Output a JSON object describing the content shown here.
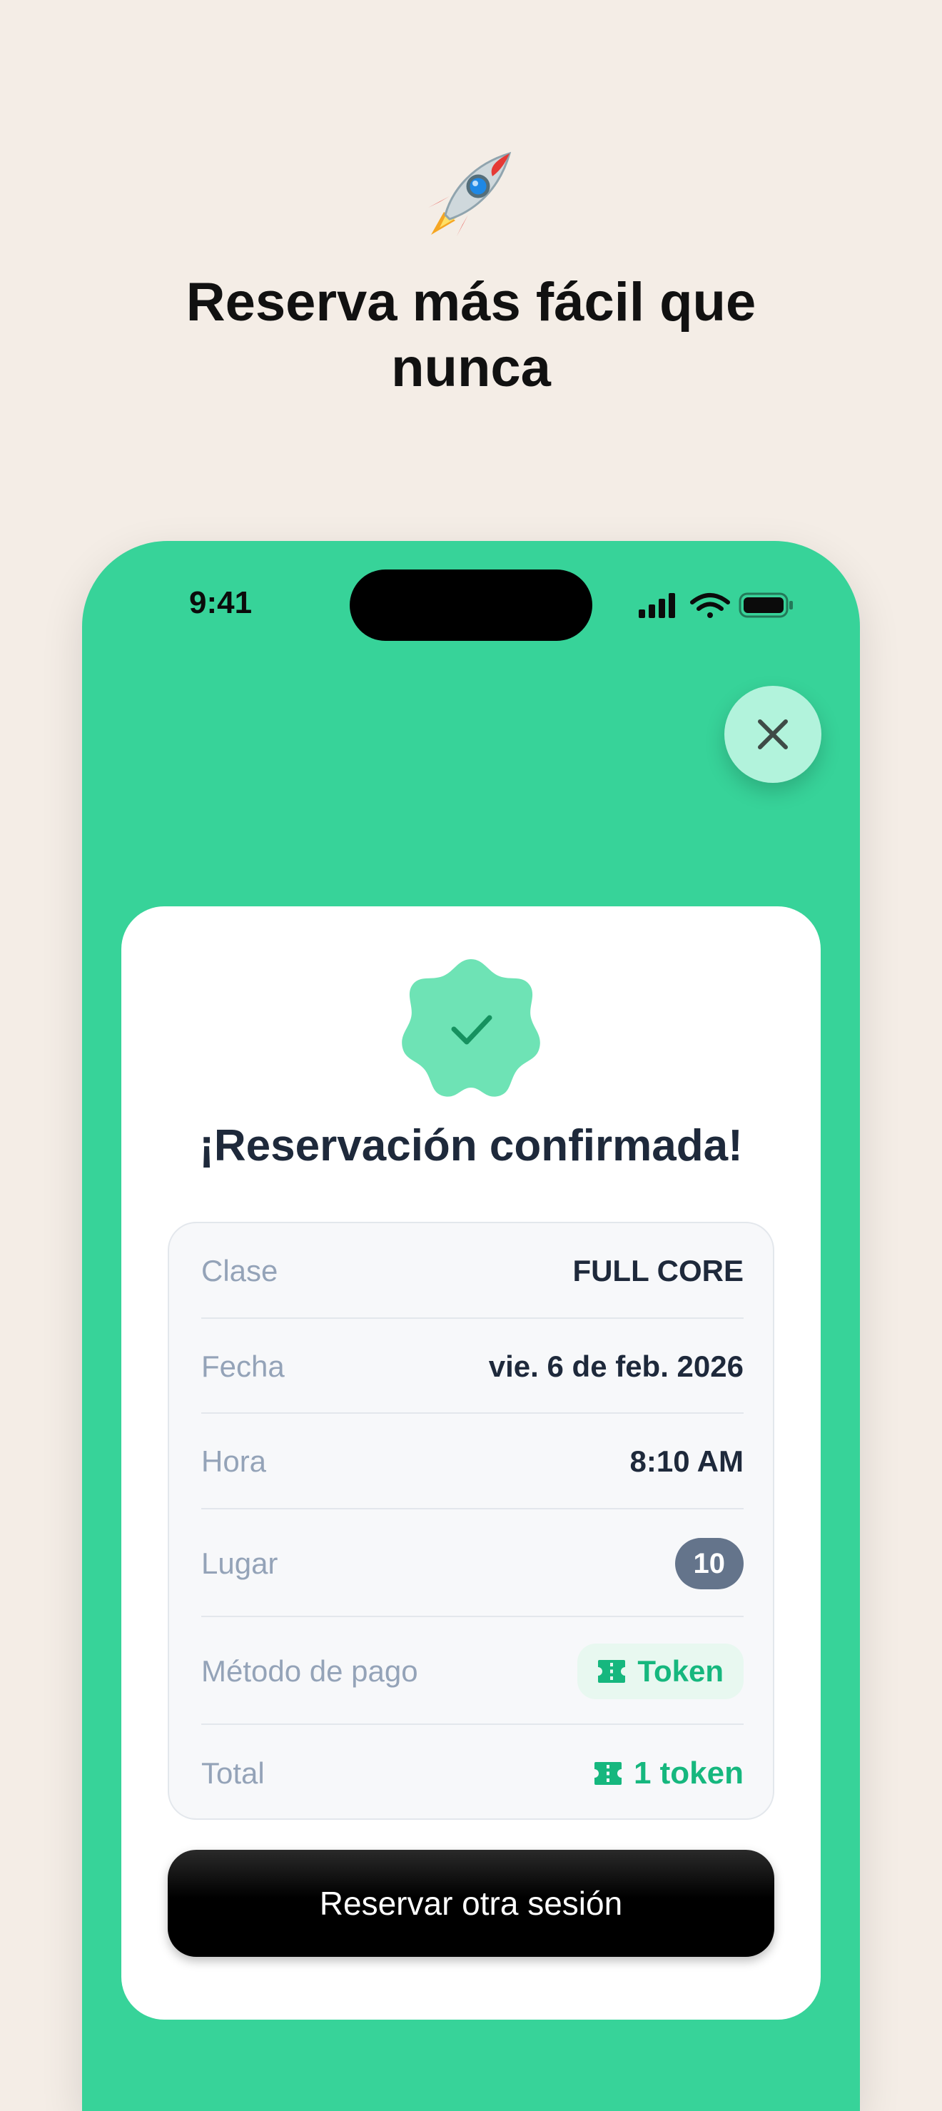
{
  "hero": {
    "icon": "rocket-icon",
    "headline_line1": "Reserva más fácil que",
    "headline_line2": "nunca"
  },
  "status_bar": {
    "time": "9:41"
  },
  "confirmation": {
    "title": "¡Reservación confirmada!",
    "rows": {
      "clase": {
        "label": "Clase",
        "value": "FULL CORE"
      },
      "fecha": {
        "label": "Fecha",
        "value": "vie. 6 de feb. 2026"
      },
      "hora": {
        "label": "Hora",
        "value": "8:10 AM"
      },
      "lugar": {
        "label": "Lugar",
        "value": "10"
      },
      "metodo": {
        "label": "Método de pago",
        "value": "Token"
      },
      "total": {
        "label": "Total",
        "value": "1 token"
      }
    },
    "cta_label": "Reservar otra sesión"
  },
  "colors": {
    "background": "#f4ede6",
    "phone_green": "#37d399",
    "accent_green": "#16b77e",
    "badge_green": "#6ee3b5"
  }
}
